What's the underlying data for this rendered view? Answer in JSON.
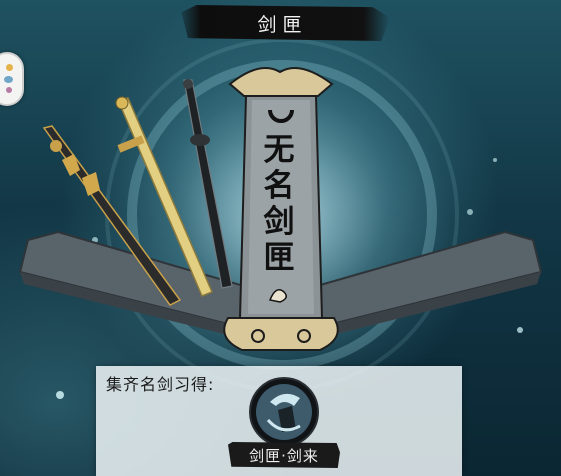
{
  "header": {
    "title": "剑匣"
  },
  "sign": {
    "lines": [
      "无",
      "名",
      "剑",
      "匣"
    ]
  },
  "reward_panel": {
    "label": "集齐名剑习得:",
    "reward_name": "剑匣·剑来"
  },
  "icons": {
    "side_button": "menu-badge-icon",
    "reward": "skill-icon",
    "swords": [
      "golden-serrated-sword-icon",
      "golden-jade-sword-icon",
      "black-sword-icon"
    ]
  },
  "colors": {
    "background": "#123746",
    "stone": "#6f777d",
    "panel": "#e8f0f2",
    "banner": "#111111"
  }
}
